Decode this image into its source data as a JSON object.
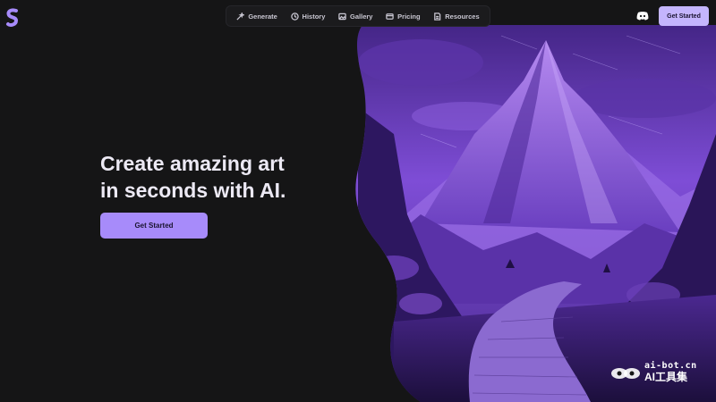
{
  "brand": {
    "logo_icon": "s-logo-icon",
    "accent": "#a78bfa"
  },
  "nav": {
    "items": [
      {
        "label": "Generate",
        "icon": "magic-wand-icon"
      },
      {
        "label": "History",
        "icon": "history-icon"
      },
      {
        "label": "Gallery",
        "icon": "image-icon"
      },
      {
        "label": "Pricing",
        "icon": "pricing-icon"
      },
      {
        "label": "Resources",
        "icon": "resources-icon"
      }
    ]
  },
  "header": {
    "discord_icon": "discord-icon",
    "cta_label": "Get Started"
  },
  "hero": {
    "headline_line1": "Create amazing art",
    "headline_line2": "in seconds with AI.",
    "cta_label": "Get Started",
    "image": "purple-mountain-landscape"
  },
  "watermark": {
    "line1": "ai-bot.cn",
    "line2": "AI工具集"
  }
}
